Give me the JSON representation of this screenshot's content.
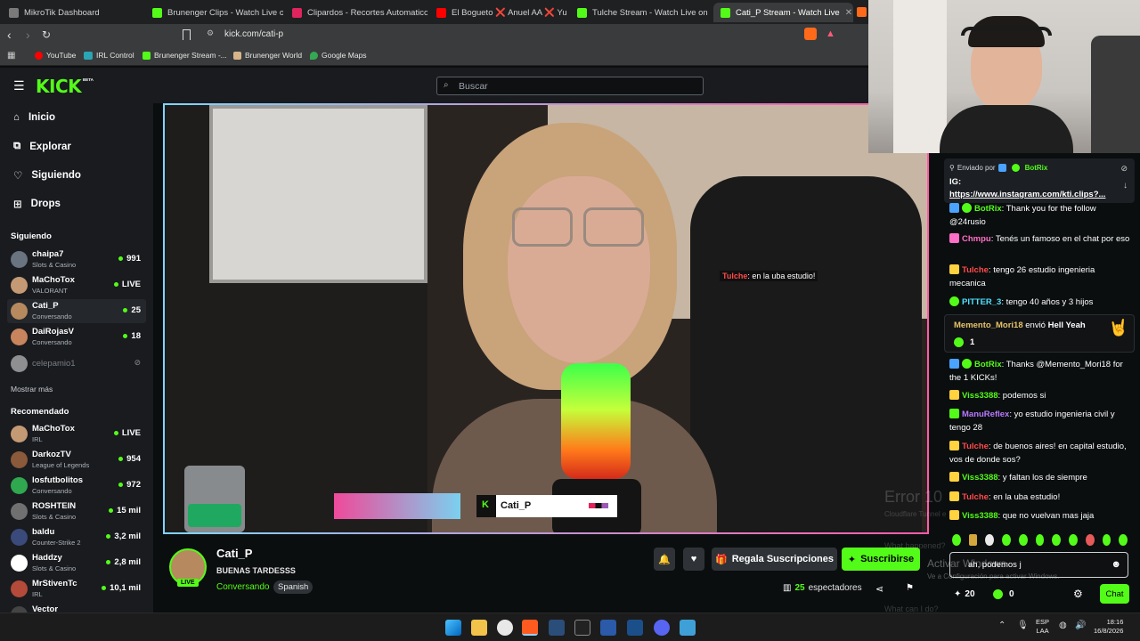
{
  "browser": {
    "tabs": [
      {
        "title": "MikroTik Dashboard",
        "color": "#7a7a7a"
      },
      {
        "title": "Brunenger Clips - Watch Live on Kick",
        "color": "#53fc18"
      },
      {
        "title": "Clipardos - Recortes Automaticos",
        "color": "#e0245e"
      },
      {
        "title": "El Bogueto ❌ Anuel AA ❌ Yung B",
        "color": "#ff0000"
      },
      {
        "title": "Tulche Stream - Watch Live on Kick",
        "color": "#53fc18"
      },
      {
        "title": "Cati_P Stream - Watch Live",
        "color": "#53fc18"
      }
    ],
    "url": "kick.com/cati-p",
    "bookmarks": [
      "YouTube",
      "IRL Control",
      "Brunenger Stream -...",
      "Brunenger World",
      "Google Maps"
    ]
  },
  "kick": {
    "logo": "KICK",
    "logo_sup": "BETA",
    "search_placeholder": "Buscar",
    "nav": [
      "Inicio",
      "Explorar",
      "Siguiendo",
      "Drops"
    ],
    "following_title": "Siguiendo",
    "following": [
      {
        "name": "chaipa7",
        "category": "Slots & Casino",
        "viewers": "991",
        "color": "#6a7380"
      },
      {
        "name": "MaChoTox",
        "category": "VALORANT",
        "viewers": "LIVE",
        "color": "#c49a74"
      },
      {
        "name": "Cati_P",
        "category": "Conversando",
        "viewers": "25",
        "color": "#b68a5e"
      },
      {
        "name": "DaiRojasV",
        "category": "Conversando",
        "viewers": "18",
        "color": "#c7845d"
      },
      {
        "name": "celepamio1",
        "category": "",
        "viewers": "",
        "color": "#dddddd"
      }
    ],
    "show_more": "Mostrar más",
    "recommended_title": "Recomendado",
    "recommended": [
      {
        "name": "MaChoTox",
        "category": "IRL",
        "viewers": "LIVE",
        "color": "#c49a74"
      },
      {
        "name": "DarkozTV",
        "category": "League of Legends",
        "viewers": "954",
        "color": "#8a5a3a"
      },
      {
        "name": "losfutbolitos",
        "category": "Conversando",
        "viewers": "972",
        "color": "#2fa84f"
      },
      {
        "name": "ROSHTEIN",
        "category": "Slots & Casino",
        "viewers": "15 mil",
        "color": "#707070"
      },
      {
        "name": "baldu",
        "category": "Counter-Strike 2",
        "viewers": "3,2 mil",
        "color": "#3a4a7a"
      },
      {
        "name": "Haddzy",
        "category": "Slots & Casino",
        "viewers": "2,8 mil",
        "color": "#ffffff"
      },
      {
        "name": "MrStivenTc",
        "category": "IRL",
        "viewers": "10,1 mil",
        "color": "#b34a3a"
      },
      {
        "name": "Vector",
        "category": "",
        "viewers": "",
        "color": "#444"
      }
    ],
    "overlay_chat": {
      "user": "Tulche",
      "text": ": en la uba estudio!"
    },
    "overlay_name": "Cati_P",
    "streamer": {
      "name": "Cati_P",
      "title": "BUENAS TARDESSS",
      "category": "Conversando",
      "tag": "Spanish",
      "live": "LIVE",
      "viewers": "25",
      "viewers_label": "espectadores"
    },
    "buttons": {
      "gift": "Regala Suscripciones",
      "subscribe": "Suscribirse"
    },
    "chat": {
      "pinned_by": "Enviado por",
      "pinned_user": "BotRix",
      "pinned_text": "IG:",
      "pinned_link": "https://www.instagram.com/kti.clips?...",
      "messages": [
        {
          "user": "BotRix",
          "color": "#53fc18",
          "badge": "#4aa3ff",
          "text": ": Thank you for the follow @24rusio"
        },
        {
          "user": "Chmpu",
          "color": "#ff6ec7",
          "badge": "#ff6ec7",
          "text": ": Tenés un famoso en el chat por eso"
        },
        {
          "user": "Tulche",
          "color": "#ff4b4b",
          "badge": "#ffd23f",
          "text": ": tengo 26 estudio ingenieria mecanica"
        },
        {
          "user": "PITTER_3",
          "color": "#4ee1ff",
          "badge": "",
          "text": ": tengo 40 años y 3 hijos"
        },
        {
          "user": "BotRix",
          "color": "#53fc18",
          "badge": "#4aa3ff",
          "text": ": Thanks @Memento_Mori18 for the 1 KICKs!"
        },
        {
          "user": "Viss3388",
          "color": "#53fc18",
          "badge": "#ffd23f",
          "text": ": podemos si"
        },
        {
          "user": "ManuReflex",
          "color": "#b97aff",
          "badge": "#53fc18",
          "text": ": yo estudio ingenieria civil y tengo 28"
        },
        {
          "user": "Tulche",
          "color": "#ff4b4b",
          "badge": "#ffd23f",
          "text": ": de buenos aires! en capital estudio, vos de donde sos?"
        },
        {
          "user": "Viss3388",
          "color": "#53fc18",
          "badge": "#ffd23f",
          "text": ": y faltan los de siempre"
        },
        {
          "user": "Tulche",
          "color": "#ff4b4b",
          "badge": "#ffd23f",
          "text": ": en la uba estudio!"
        },
        {
          "user": "Viss3388",
          "color": "#53fc18",
          "badge": "#ffd23f",
          "text": ": que no vuelvan mas jaja"
        }
      ],
      "gift": {
        "user": "Memento_Mori18",
        "text": "envió",
        "item": "Hell Yeah",
        "amount": "1"
      },
      "input_value": "ah, podemos j",
      "points": "20",
      "kicks": "0",
      "send_label": "Chat"
    }
  },
  "overlay_text": {
    "error": "Error 10",
    "cloudflare": "Cloudflare Tunnel e",
    "what_happened": "What happened?",
    "activate": "Activar Windows",
    "activate_sub": "Ve a Configuración para activar Windows.",
    "what_can": "What can I do?"
  },
  "taskbar": {
    "lang": "ESP",
    "lang2": "LAA",
    "time": "18:16",
    "date": "16/8/2026"
  }
}
